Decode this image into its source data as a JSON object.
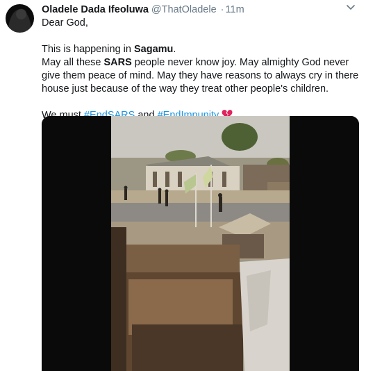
{
  "tweet": {
    "author_name": "Oladele Dada Ifeoluwa",
    "handle": "@ThatOladele",
    "separator": "·",
    "time": "11m",
    "line1": "Dear God,",
    "line2_prefix": "This is happening in ",
    "line2_bold": "Sagamu",
    "line2_suffix": ".",
    "line3_prefix": "May all these ",
    "line3_bold": "SARS",
    "line3_suffix": " people never know joy. May almighty God never give them peace of mind. May they have reasons to always cry in there house just because of the way they treat other people's children.",
    "line4_prefix": "We must ",
    "hashtag1": "#EndSARS",
    "line4_mid": " and ",
    "hashtag2": "#EndImpunity",
    "emoji": "broken-heart-icon"
  },
  "colors": {
    "link": "#1b95e0",
    "secondary": "#657786",
    "emoji": "#e0245e"
  }
}
